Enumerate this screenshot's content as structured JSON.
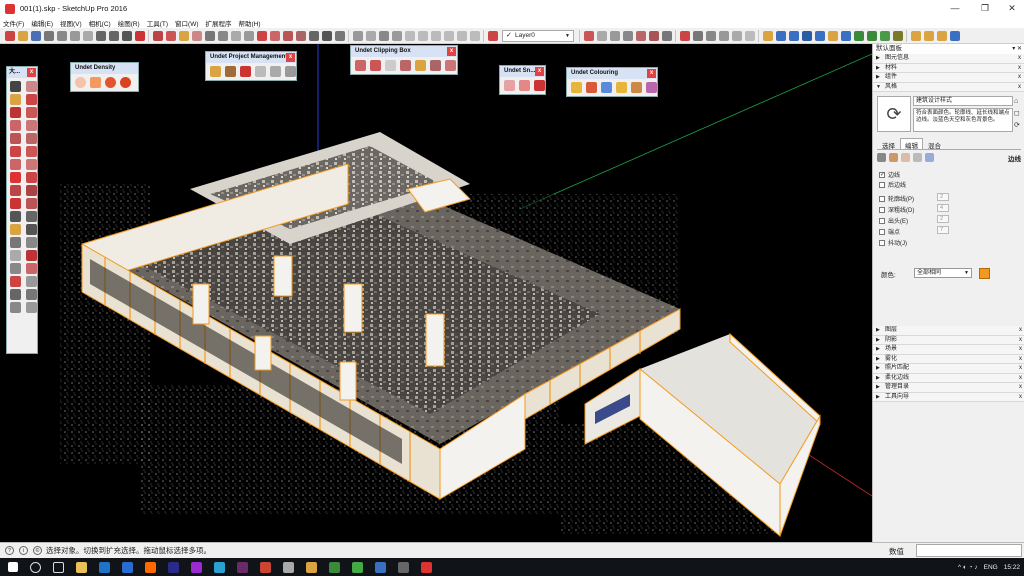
{
  "window": {
    "title": "001(1).skp - SketchUp Pro 2016",
    "minimize": "—",
    "maximize": "❐",
    "close": "✕"
  },
  "menu": [
    "文件(F)",
    "编辑(E)",
    "视图(V)",
    "相机(C)",
    "绘图(R)",
    "工具(T)",
    "窗口(W)",
    "扩展程序",
    "帮助(H)"
  ],
  "toolbar": {
    "layer_value": "Layer0",
    "layer_check": "✓",
    "layer_arrow": "▼"
  },
  "palettes": {
    "large_tools": {
      "title": "大..."
    },
    "density": {
      "title": "Undet Density"
    },
    "project": {
      "title": "Undet Project Management"
    },
    "clipping": {
      "title": "Undet Clipping Box"
    },
    "snapping": {
      "title": "Undet Sn..."
    },
    "colouring": {
      "title": "Undet Colouring"
    },
    "close_glyph": "x"
  },
  "tray": {
    "title": "默认面板",
    "pin": "▾ ✕",
    "top_panels": [
      {
        "label": "图元信息",
        "arrow": "▶"
      },
      {
        "label": "材料",
        "arrow": "▶"
      },
      {
        "label": "组件",
        "arrow": "▶"
      },
      {
        "label": "风格",
        "arrow": "▼"
      }
    ],
    "panel_close": "x",
    "style": {
      "name": "建筑设计样式",
      "description": "符合表面颜色。轮廓线、延长线和端点边线。淡蓝色天空和灰色背景色。",
      "preview_glyph": "⟳",
      "side_icons": "⌂ ◻ ⟳"
    },
    "tabs": [
      "选择",
      "编辑",
      "混合"
    ],
    "edit_section_label": "边线",
    "options": [
      {
        "label": "边线",
        "checked": "✓",
        "value": ""
      },
      {
        "label": "后边线",
        "checked": "",
        "value": ""
      },
      {
        "label": "轮廓线(P)",
        "checked": "",
        "value": "2"
      },
      {
        "label": "深粗线(D)",
        "checked": "",
        "value": "4"
      },
      {
        "label": "出头(E)",
        "checked": "",
        "value": "2"
      },
      {
        "label": "端点",
        "checked": "",
        "value": "7"
      },
      {
        "label": "抖动(J)",
        "checked": "",
        "value": ""
      }
    ],
    "color_label": "颜色:",
    "color_value": "全部相同",
    "color_swatch": "#f39a1e",
    "lower_panels": [
      {
        "label": "图层",
        "arrow": "▶"
      },
      {
        "label": "阴影",
        "arrow": "▶"
      },
      {
        "label": "场景",
        "arrow": "▶"
      },
      {
        "label": "雾化",
        "arrow": "▶"
      },
      {
        "label": "照片匹配",
        "arrow": "▶"
      },
      {
        "label": "柔化边线",
        "arrow": "▶"
      },
      {
        "label": "管理目录",
        "arrow": "▶"
      },
      {
        "label": "工具向导",
        "arrow": "▶"
      }
    ]
  },
  "status": {
    "text": "选择对象。切换到扩充选择。拖动鼠标选择多项。",
    "icons": [
      "?",
      "i",
      "©"
    ],
    "measure_label": "数值",
    "measure_value": ""
  },
  "taskbar": {
    "time": "15:22",
    "lang": "ENG",
    "tray_glyphs": "^ ◐ ◔ ♪"
  },
  "colors": {
    "accent_orange": "#f39a1e",
    "viewport_bg": "#000000",
    "header_blue": "#d7e3f4"
  }
}
